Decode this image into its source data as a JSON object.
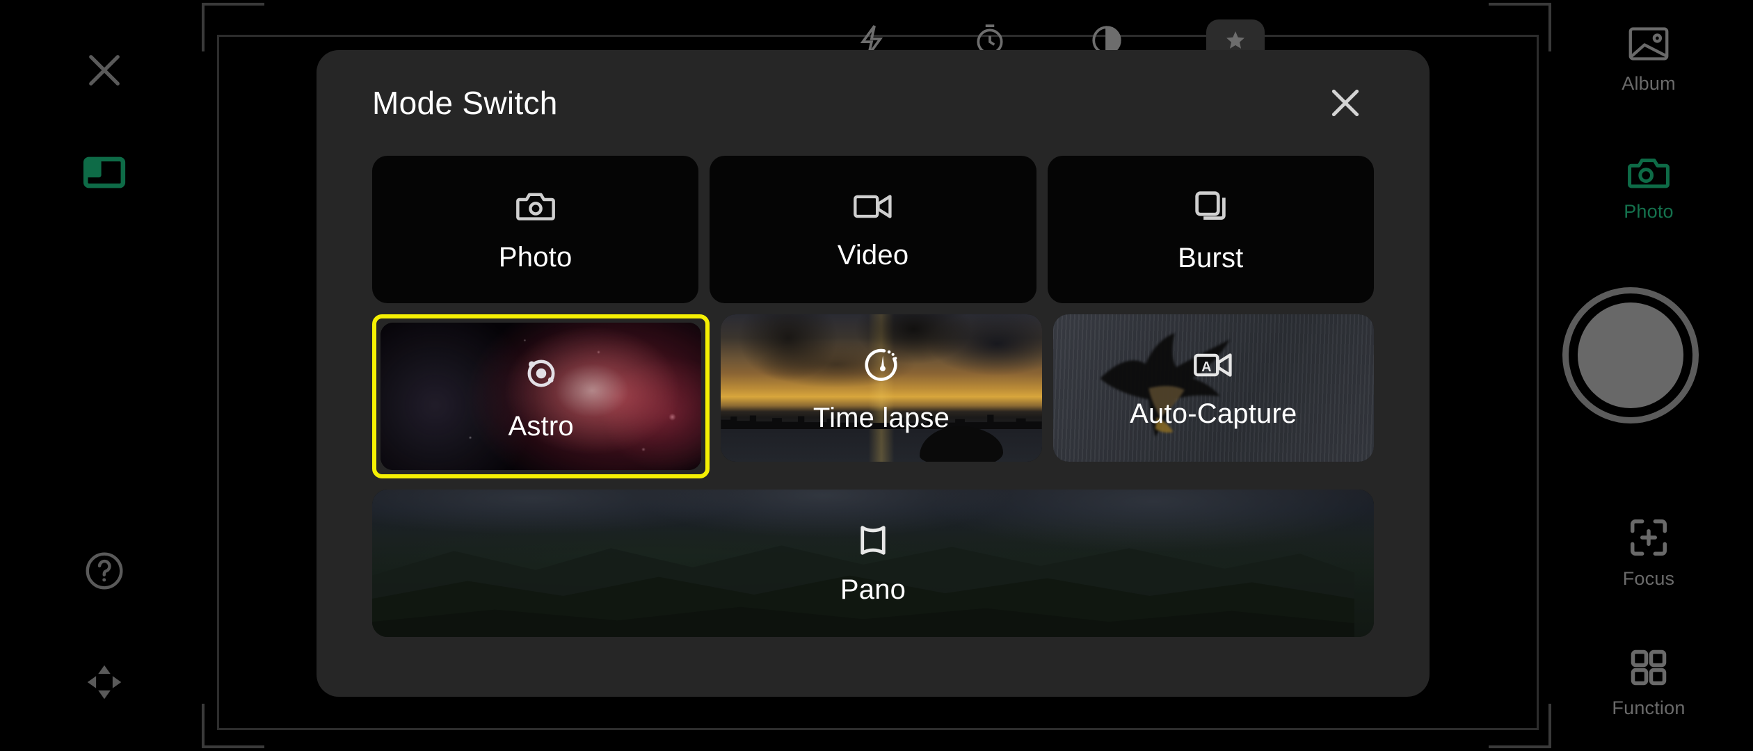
{
  "dialog": {
    "title": "Mode Switch",
    "close_icon": "close-icon",
    "rows": [
      [
        {
          "label": "Photo",
          "icon": "camera-icon",
          "selected": false,
          "thumb": "none"
        },
        {
          "label": "Video",
          "icon": "video-camera-icon",
          "selected": false,
          "thumb": "none"
        },
        {
          "label": "Burst",
          "icon": "stacked-squares-icon",
          "selected": false,
          "thumb": "none"
        }
      ],
      [
        {
          "label": "Astro",
          "icon": "orbit-icon",
          "selected": true,
          "thumb": "nebula"
        },
        {
          "label": "Time lapse",
          "icon": "stopwatch-icon",
          "selected": false,
          "thumb": "sunset-skyline"
        },
        {
          "label": "Auto-Capture",
          "icon": "auto-video-camera-icon",
          "selected": false,
          "thumb": "eagle-motion-blur"
        }
      ],
      [
        {
          "label": "Pano",
          "icon": "panorama-icon",
          "selected": false,
          "thumb": "mountain-valley"
        }
      ]
    ]
  },
  "rail_left": [
    {
      "label": "",
      "icon": "close-icon",
      "accent": false
    },
    {
      "label": "",
      "icon": "pip-layout-icon",
      "accent": true
    },
    {
      "label": "",
      "icon": "help-circle-icon",
      "accent": false
    },
    {
      "label": "",
      "icon": "pan-arrows-icon",
      "accent": false
    }
  ],
  "rail_right": [
    {
      "label": "Album",
      "icon": "image-icon",
      "accent": false
    },
    {
      "label": "Photo",
      "icon": "camera-icon",
      "accent": true
    },
    {
      "label": "Focus",
      "icon": "focus-target-icon",
      "accent": false
    },
    {
      "label": "Function",
      "icon": "grid-2x2-icon",
      "accent": false
    }
  ],
  "shutter": {
    "name": "shutter-button"
  },
  "colors": {
    "dialog_bg": "#262626",
    "tile_bg": "#050505",
    "selection": "#f5f003",
    "accent_green": "#0e6b47",
    "rail_gray": "#6a6a6a",
    "text": "#ffffff"
  }
}
